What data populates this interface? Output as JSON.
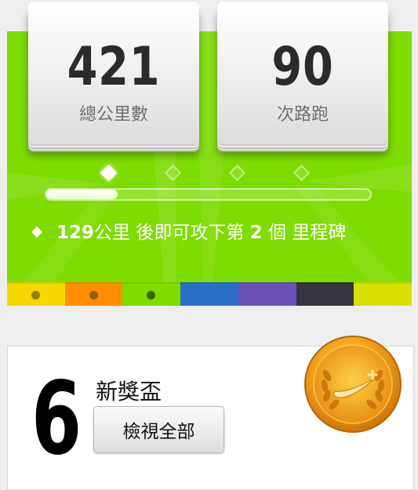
{
  "stats": {
    "distance": {
      "value": "421",
      "label": "總公里數"
    },
    "runs": {
      "value": "90",
      "label": "次路跑"
    }
  },
  "progress": {
    "fraction": 0.22,
    "milestones_reached": 1,
    "milestone_count": 4,
    "message": {
      "distance": "129",
      "unit_text": "公里 後即可攻下第 ",
      "milestone_number": "2",
      "suffix": " 個 里程碑"
    }
  },
  "levels": {
    "colors": [
      "#f6d800",
      "#ff8e00",
      "#7ddc00",
      "#2a70c8",
      "#6a52b8",
      "#34343e",
      "#d9e000"
    ],
    "current_index": 2
  },
  "trophies": {
    "count": "6",
    "label": "新獎盃",
    "view_all_label": "檢視全部",
    "medal_icon": "gold-medal-icon"
  }
}
